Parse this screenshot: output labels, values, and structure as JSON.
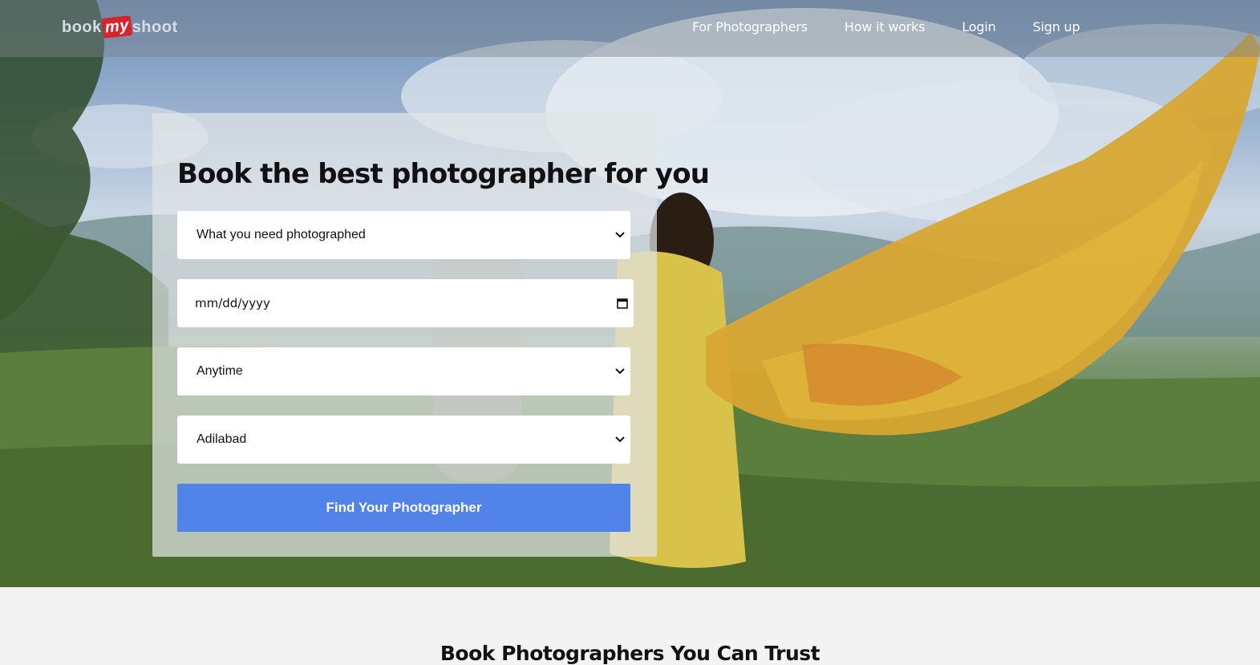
{
  "brand": {
    "logo_part1": "book",
    "logo_part2": "my",
    "logo_part3": "shoot",
    "accent_color": "#d7232b"
  },
  "navbar": {
    "links": [
      {
        "label": "For Photographers"
      },
      {
        "label": "How it works"
      },
      {
        "label": "Login"
      },
      {
        "label": "Sign up"
      }
    ]
  },
  "booking_form": {
    "title": "Book the best photographer for you",
    "category_select": {
      "selected": "What you need photographed",
      "icon": "chevron-down-icon"
    },
    "date_input": {
      "placeholder": "mm/dd/yyyy",
      "icon": "calendar-icon"
    },
    "time_select": {
      "selected": "Anytime",
      "icon": "chevron-down-icon"
    },
    "city_select": {
      "selected": "Adilabad",
      "icon": "chevron-down-icon"
    },
    "submit_label": "Find Your Photographer",
    "button_color": "#5183e8"
  },
  "trust_section": {
    "title": "Book Photographers You Can Trust"
  }
}
